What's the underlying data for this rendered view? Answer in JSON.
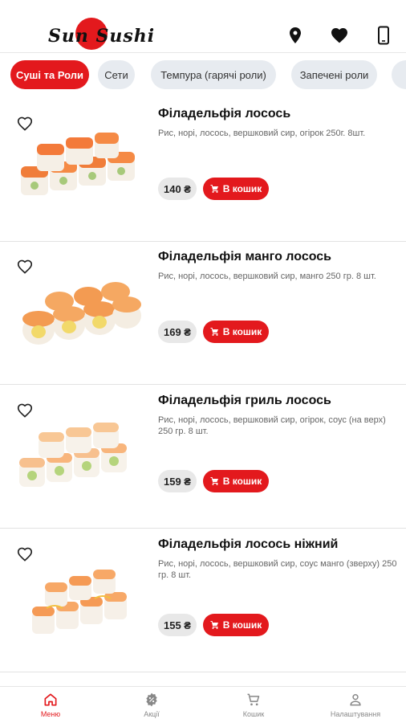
{
  "header": {
    "logo_text": "Sun Sushi",
    "icons": [
      "location-icon",
      "heart-icon",
      "phone-icon"
    ]
  },
  "tabs": [
    {
      "label": "Суші та Роли",
      "active": true
    },
    {
      "label": "Сети",
      "active": false
    },
    {
      "label": "Темпура (гарячі роли)",
      "active": false
    },
    {
      "label": "Запечені роли",
      "active": false
    },
    {
      "label": "",
      "active": false
    }
  ],
  "products": [
    {
      "name": "Філадельфія лосось",
      "description": "Рис, норі, лосось, вершковий сир, огірок 250г. 8шт.",
      "price": "140 ₴",
      "cart_label": "В кошик"
    },
    {
      "name": "Філадельфія манго лосось",
      "description": "Рис, норі, лосось, вершковий сир, манго 250 гр. 8 шт.",
      "price": "169 ₴",
      "cart_label": "В кошик"
    },
    {
      "name": "Філадельфія гриль лосось",
      "description": "Рис, норі, лосось, вершковий сир, огірок, соус (на верх) 250 гр. 8 шт.",
      "price": "159 ₴",
      "cart_label": "В кошик"
    },
    {
      "name": "Філадельфія лосось ніжний",
      "description": "Рис, норі, лосось, вершковий сир, соус манго (зверху) 250 гр. 8 шт.",
      "price": "155 ₴",
      "cart_label": "В кошик"
    }
  ],
  "bottom_nav": [
    {
      "label": "Меню",
      "icon": "home-icon",
      "active": true
    },
    {
      "label": "Акції",
      "icon": "discount-icon",
      "active": false
    },
    {
      "label": "Кошик",
      "icon": "cart-icon",
      "active": false
    },
    {
      "label": "Налаштування",
      "icon": "person-icon",
      "active": false
    }
  ],
  "colors": {
    "accent": "#e3191d",
    "chip": "#e7ebf0",
    "price_bg": "#e8e8e8"
  }
}
